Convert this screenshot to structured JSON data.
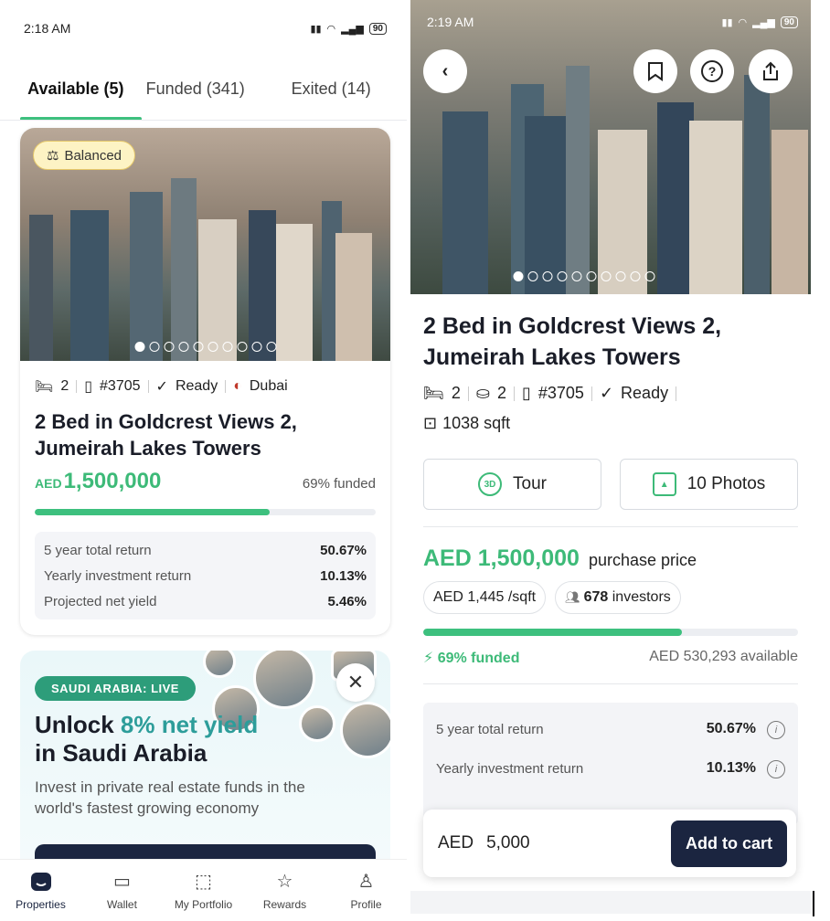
{
  "left": {
    "status": {
      "time": "2:18 AM",
      "battery": "90"
    },
    "tabs": [
      {
        "label": "Available (5)"
      },
      {
        "label": "Funded (341)"
      },
      {
        "label": "Exited (14)"
      }
    ],
    "card": {
      "badge": "Balanced",
      "beds": "2",
      "unit": "#3705",
      "status": "Ready",
      "city": "Dubai",
      "title": "2 Bed in Goldcrest Views 2, Jumeirah Lakes Towers",
      "currency": "AED",
      "price": "1,500,000",
      "funded": "69% funded",
      "funded_fraction": 0.69,
      "returns": [
        {
          "label": "5 year total return",
          "value": "50.67%"
        },
        {
          "label": "Yearly investment return",
          "value": "10.13%"
        },
        {
          "label": "Projected net yield",
          "value": "5.46%"
        }
      ]
    },
    "promo": {
      "chip": "SAUDI ARABIA: LIVE",
      "title_a": "Unlock",
      "title_hl": "8% net yield",
      "title_b": "in Saudi Arabia",
      "desc": "Invest in private real estate funds in the world's fastest growing economy"
    },
    "nav": [
      {
        "label": "Properties",
        "icon": "home-icon"
      },
      {
        "label": "Wallet",
        "icon": "wallet-icon"
      },
      {
        "label": "My Portfolio",
        "icon": "portfolio-icon"
      },
      {
        "label": "Rewards",
        "icon": "star-icon"
      },
      {
        "label": "Profile",
        "icon": "profile-icon"
      }
    ]
  },
  "right": {
    "status": {
      "time": "2:19 AM",
      "battery": "90"
    },
    "title": "2 Bed in Goldcrest Views 2, Jumeirah Lakes Towers",
    "beds": "2",
    "baths": "2",
    "unit": "#3705",
    "status_text": "Ready",
    "sqft": "1038 sqft",
    "tour_label": "Tour",
    "photos_label": "10 Photos",
    "price": "AED 1,500,000",
    "price_label": "purchase price",
    "per_sqft": "AED 1,445",
    "per_sqft_unit": "/sqft",
    "investors_count": "678",
    "investors_label": "investors",
    "funded": "69% funded",
    "funded_fraction": 0.69,
    "available": "AED 530,293 available",
    "returns": [
      {
        "label": "5 year total return",
        "value": "50.67%"
      },
      {
        "label": "Yearly investment return",
        "value": "10.13%"
      }
    ],
    "cart": {
      "currency": "AED",
      "amount": "5,000",
      "button": "Add to cart"
    }
  }
}
